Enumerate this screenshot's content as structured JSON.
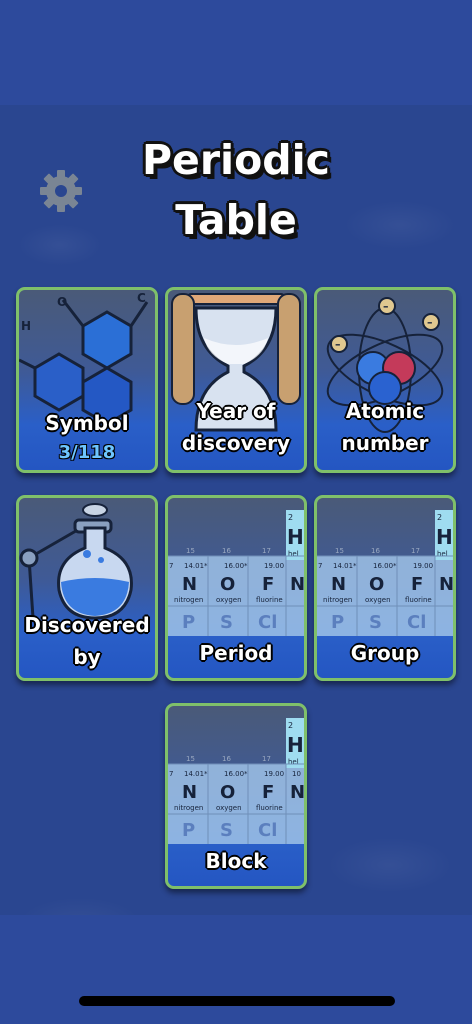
{
  "title": {
    "line1": "Periodic",
    "line2": "Table"
  },
  "settings": {
    "icon": "gear-icon"
  },
  "cards": {
    "symbol": {
      "label": "Symbol",
      "progress": "3/118"
    },
    "year": {
      "label1": "Year of",
      "label2": "discovery"
    },
    "atomic": {
      "label1": "Atomic",
      "label2": "number"
    },
    "discovered": {
      "label1": "Discovered",
      "label2": "by"
    },
    "period": {
      "label": "Period"
    },
    "group": {
      "label": "Group"
    },
    "block": {
      "label": "Block"
    }
  },
  "table_art": {
    "groups": [
      "15",
      "16",
      "17",
      "18"
    ],
    "masses": [
      "14.01*",
      "16.00*",
      "19.00"
    ],
    "symbols": [
      "N",
      "O",
      "F"
    ],
    "names": [
      "nitrogen",
      "oxygen",
      "fluorine"
    ],
    "lower_symbols": [
      "P",
      "S",
      "Cl"
    ],
    "he_number": "2",
    "he_symbol": "H",
    "he_name": "hel",
    "row_number": "7",
    "ne_number": "10",
    "ne_symbol": "N"
  },
  "colors": {
    "background": "#2d4a9c",
    "card_border": "#7fc06a",
    "progress_text": "#6ec6ff"
  }
}
